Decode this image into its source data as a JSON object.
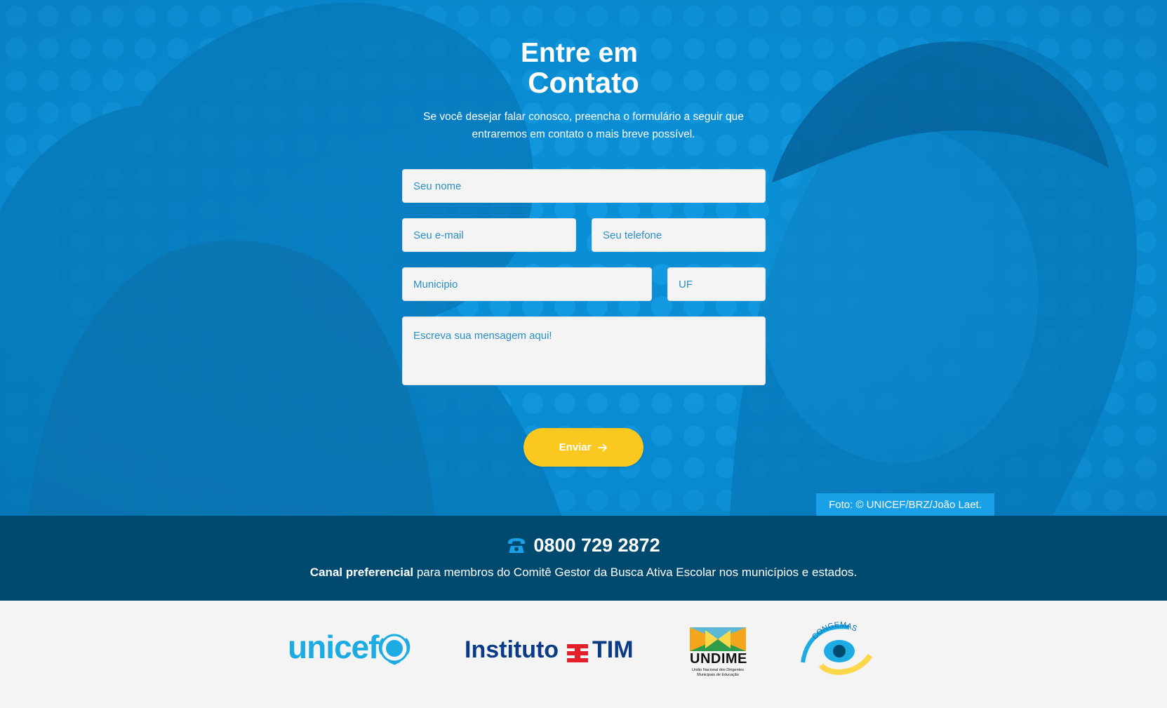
{
  "hero": {
    "title_line1": "Entre em",
    "title_line2": "Contato",
    "subtitle_line1": "Se você desejar falar conosco, preencha o formulário a seguir que",
    "subtitle_line2": "entraremos em contato o mais breve possível.",
    "photo_credit": "Foto: © UNICEF/BRZ/João Laet."
  },
  "form": {
    "name_placeholder": "Seu nome",
    "email_placeholder": "Seu e-mail",
    "phone_placeholder": "Seu telefone",
    "city_placeholder": "Municipio",
    "state_placeholder": "UF",
    "message_placeholder": "Escreva sua mensagem aqui!",
    "submit_label": "Enviar"
  },
  "contact": {
    "phone_number": "0800 729 2872",
    "note_bold": "Canal preferencial",
    "note_rest": " para membros do Comitê Gestor da Busca Ativa Escolar nos municípios e estados."
  },
  "partners": {
    "unicef": "unicef",
    "instituto": "Instituto",
    "tim": "TIM",
    "undime": "UNDIME",
    "undime_sub": "União Nacional dos Dirigentes Municipais de Educação",
    "congemas": "CONGEMAS"
  },
  "colors": {
    "hero_blue": "#0a8fd6",
    "bar_navy": "#004a6f",
    "button_yellow": "#fbc81f",
    "placeholder_blue": "#2b8fc7"
  }
}
